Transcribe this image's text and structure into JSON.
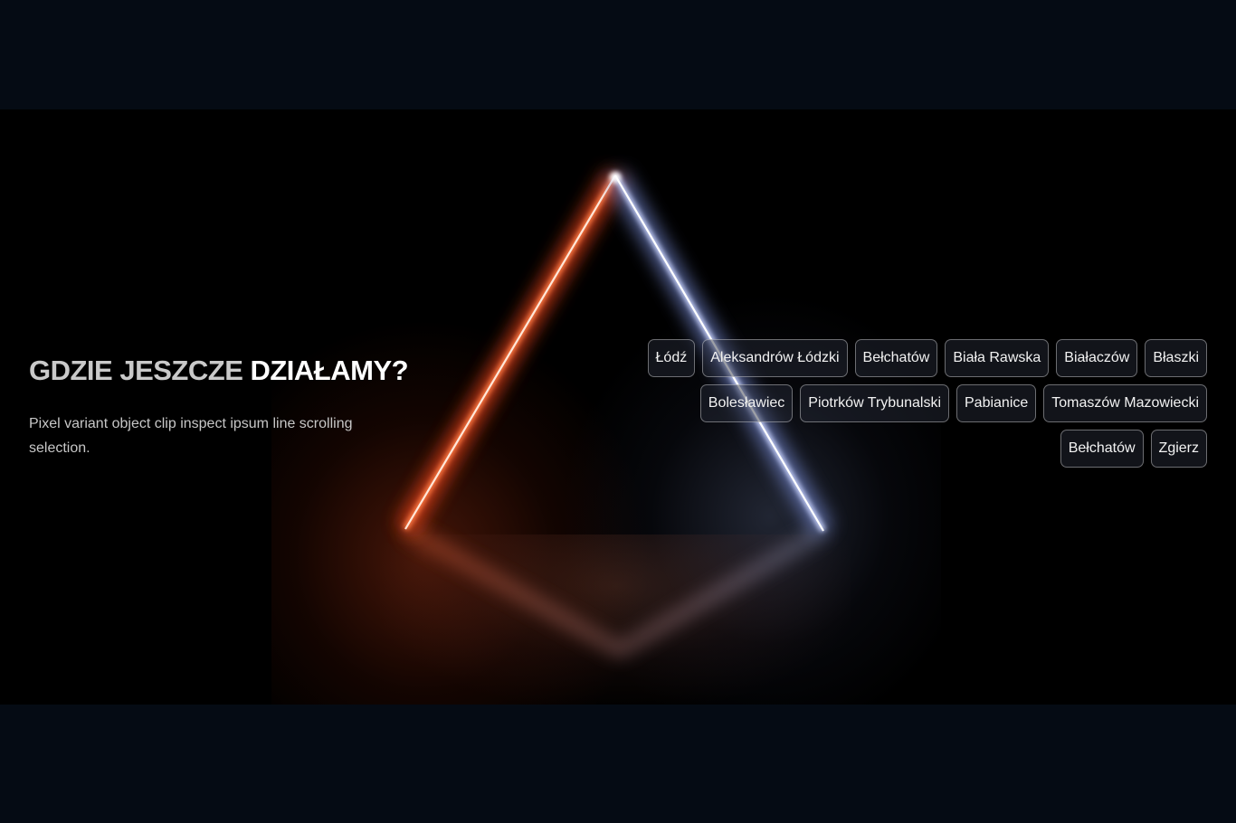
{
  "section": {
    "heading_main": "GDZIE JESZCZE ",
    "heading_accent": "DZIAŁAMY?",
    "description": "Pixel variant object clip inspect ipsum line scrolling selection."
  },
  "locations": [
    "Łódź",
    "Aleksandrów Łódzki",
    "Bełchatów",
    "Biała Rawska",
    "Białaczów",
    "Błaszki",
    "Bolesławiec",
    "Piotrków Trybunalski",
    "Pabianice",
    "Tomaszów Mazowiecki",
    "Bełchatów",
    "Zgierz"
  ],
  "colors": {
    "page_background": "#050b14",
    "hero_background": "#000000",
    "neon_left": "#ff5a2a",
    "neon_right": "#c8d4ff"
  }
}
